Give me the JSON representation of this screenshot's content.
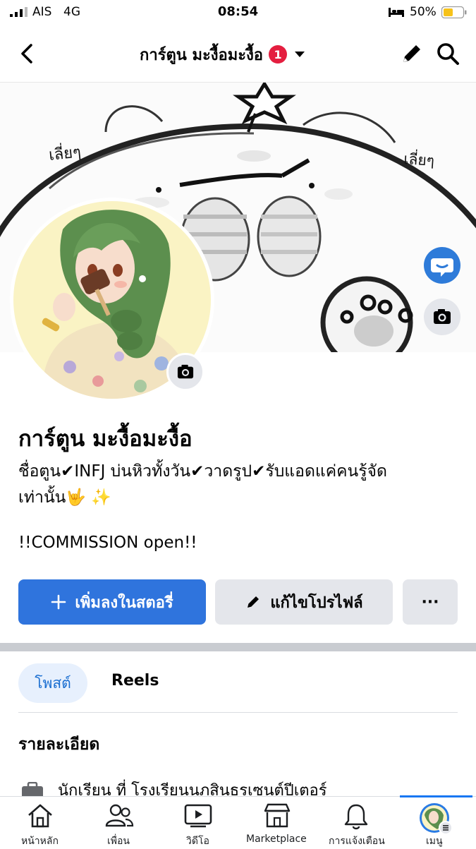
{
  "status_bar": {
    "carrier": "AIS",
    "network": "4G",
    "time": "08:54",
    "battery": "50%",
    "battery_level": 0.5,
    "icons": [
      "signal-icon",
      "bed-icon",
      "battery-icon"
    ]
  },
  "nav": {
    "title": "การ์ตูน มะงื้อมะงื้อ",
    "badge_count": "1",
    "icons": [
      "back-arrow-icon",
      "caret-down-icon",
      "pencil-icon",
      "search-icon"
    ]
  },
  "profile": {
    "name": "การ์ตูน มะงื้อมะงื้อ",
    "bio_lines": [
      "ชื่อตูน✔INFJ บ่นหิวทั้งวัน✔วาดรูป✔รับแอดแค่คนรู้จัด",
      "เท่านั้น🤟 ✨"
    ],
    "commission": "!!COMMISSION open!!"
  },
  "actions": {
    "add_story": "เพิ่มลงในสตอรี่",
    "edit_profile": "แก้ไขโปรไฟล์",
    "more": "···"
  },
  "tabs": {
    "posts": "โพสต์",
    "reels": "Reels"
  },
  "details": {
    "title": "รายละเอียด",
    "work": "นักเรียน ที่ โรงเรียนนภสินธุรเซนต์ปีเตอร์"
  },
  "tabbar": {
    "items": [
      {
        "label": "หน้าหลัก",
        "icon": "home-icon"
      },
      {
        "label": "เพื่อน",
        "icon": "friends-icon"
      },
      {
        "label": "วิดีโอ",
        "icon": "video-icon"
      },
      {
        "label": "Marketplace",
        "icon": "marketplace-icon"
      },
      {
        "label": "การแจ้งเตือน",
        "icon": "bell-icon"
      },
      {
        "label": "เมนู",
        "icon": "menu-avatar-icon"
      }
    ],
    "active": "เมนู"
  },
  "cover_text": {
    "left": "เลี่ยๆ",
    "right": "เลี่ยๆ"
  },
  "colors": {
    "primary_blue": "#2f74dd",
    "badge_red": "#e41e3f",
    "tab_highlight_bg": "#e7f0fd",
    "tab_highlight_text": "#1b6fd1",
    "button_gray": "#e4e6eb"
  }
}
